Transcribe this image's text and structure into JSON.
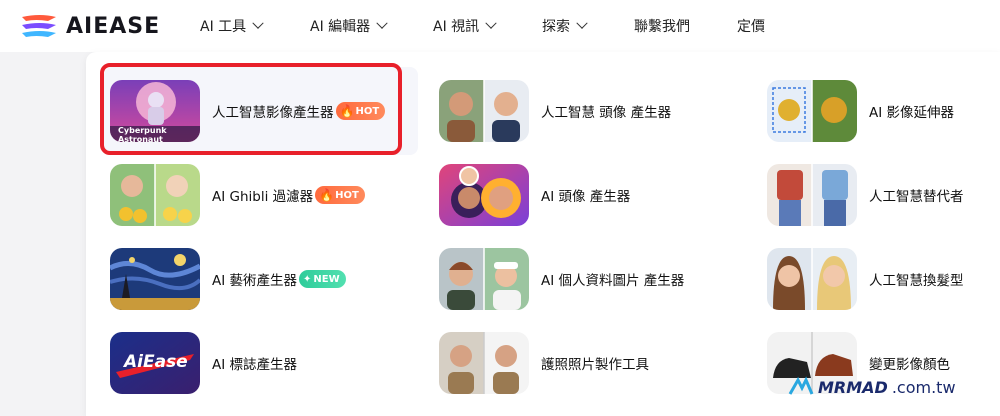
{
  "brand": {
    "name": "AIEASE"
  },
  "nav": [
    {
      "label": "AI 工具",
      "has_dropdown": true
    },
    {
      "label": "AI 編輯器",
      "has_dropdown": true
    },
    {
      "label": "AI 視訊",
      "has_dropdown": true
    },
    {
      "label": "探索",
      "has_dropdown": true
    },
    {
      "label": "聯繫我們",
      "has_dropdown": false
    },
    {
      "label": "定價",
      "has_dropdown": false
    }
  ],
  "menu": {
    "col1": [
      {
        "label": "人工智慧影像產生器",
        "badge": "HOT",
        "thumb_caption": "Cyberpunk Astronaut"
      },
      {
        "label": "AI Ghibli 過濾器",
        "badge": "HOT"
      },
      {
        "label": "AI 藝術產生器",
        "badge": "NEW"
      },
      {
        "label": "AI 標誌產生器",
        "badge": "",
        "thumb_caption": "AiEase"
      }
    ],
    "col2": [
      {
        "label": "人工智慧 頭像 產生器"
      },
      {
        "label": "AI 頭像 產生器"
      },
      {
        "label": "AI 個人資料圖片 產生器"
      },
      {
        "label": "護照照片製作工具"
      }
    ],
    "col3": [
      {
        "label": "AI 影像延伸器"
      },
      {
        "label": "人工智慧替代者"
      },
      {
        "label": "人工智慧換髮型"
      },
      {
        "label": "變更影像顏色"
      }
    ]
  },
  "watermark": {
    "brand": "MRMAD",
    "rest": ".com.tw"
  },
  "colors": {
    "highlight": "#e8202a",
    "hot": "#ff6a3d",
    "new": "#2ecc9a"
  }
}
